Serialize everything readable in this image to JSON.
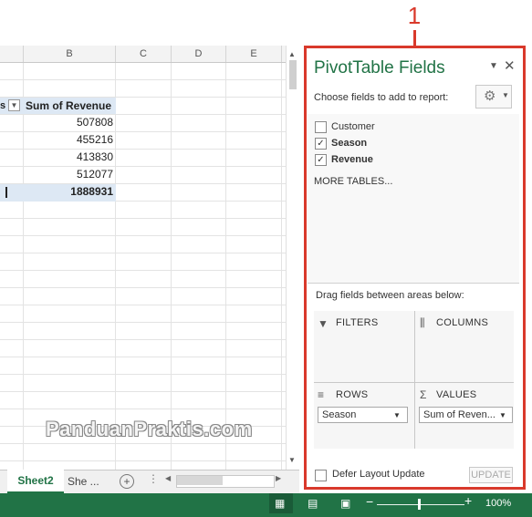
{
  "annotation": {
    "number": "1"
  },
  "sheet": {
    "columns": [
      "B",
      "C",
      "D",
      "E"
    ],
    "pivot_header": "Sum of Revenue",
    "values": [
      "507808",
      "455216",
      "413830",
      "512077"
    ],
    "total": "1888931"
  },
  "tabs": {
    "active": "Sheet2",
    "other": "She ..."
  },
  "watermark": "PanduanPraktis.com",
  "pane": {
    "title": "PivotTable Fields",
    "choose_label": "Choose fields to add to report:",
    "fields": [
      {
        "label": "Customer",
        "checked": false
      },
      {
        "label": "Season",
        "checked": true
      },
      {
        "label": "Revenue",
        "checked": true
      }
    ],
    "more_tables": "MORE TABLES...",
    "drag_label": "Drag fields between areas below:",
    "areas": {
      "filters": "FILTERS",
      "columns": "COLUMNS",
      "rows": "ROWS",
      "values": "VALUES"
    },
    "rows_item": "Season",
    "values_item": "Sum of Reven...",
    "defer_label": "Defer Layout Update",
    "update_label": "UPDATE"
  },
  "statusbar": {
    "zoom": "100%"
  },
  "colors": {
    "accent": "#217346",
    "highlight": "#d9392b"
  }
}
